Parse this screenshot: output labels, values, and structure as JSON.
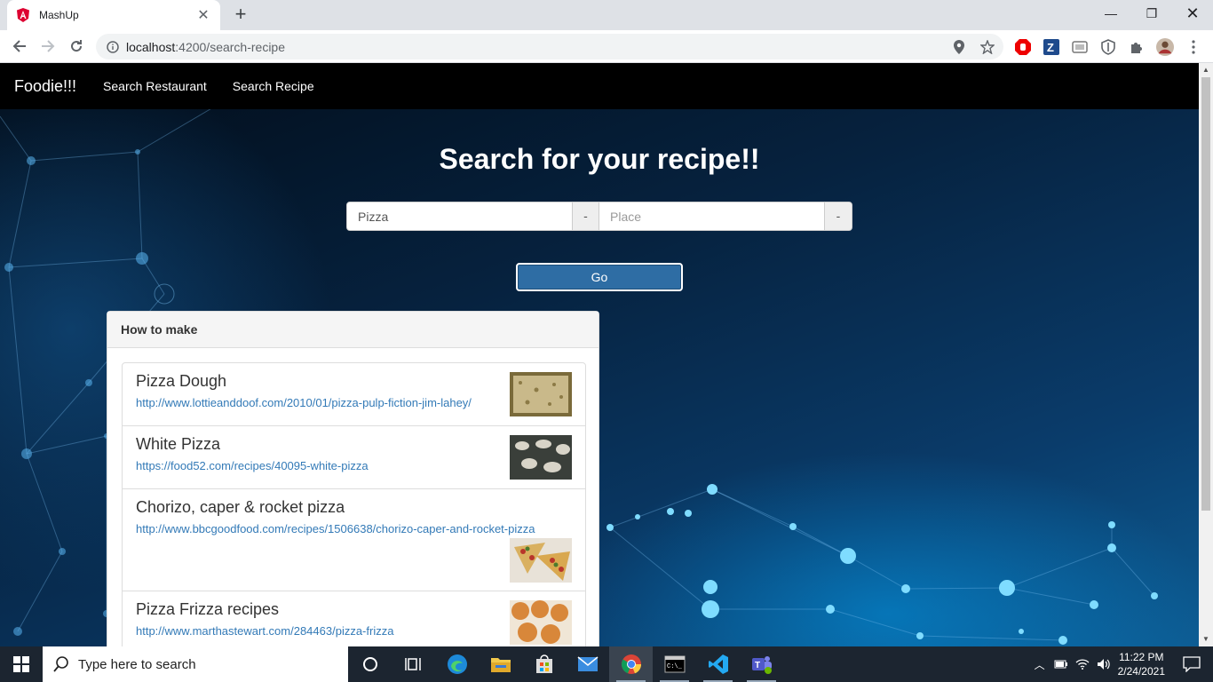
{
  "browser": {
    "tab_title": "MashUp",
    "url_host": "localhost",
    "url_rest": ":4200/search-recipe"
  },
  "navbar": {
    "brand": "Foodie!!!",
    "links": [
      "Search Restaurant",
      "Search Recipe"
    ]
  },
  "search": {
    "title": "Search for your recipe!!",
    "query_value": "Pizza",
    "query_addon": "-",
    "place_placeholder": "Place",
    "place_addon": "-",
    "go_label": "Go"
  },
  "results": {
    "heading": "How to make",
    "items": [
      {
        "title": "Pizza Dough",
        "url": "http://www.lottieanddoof.com/2010/01/pizza-pulp-fiction-jim-lahey/"
      },
      {
        "title": "White Pizza",
        "url": "https://food52.com/recipes/40095-white-pizza"
      },
      {
        "title": "Chorizo, caper & rocket pizza",
        "url": "http://www.bbcgoodfood.com/recipes/1506638/chorizo-caper-and-rocket-pizza"
      },
      {
        "title": "Pizza Frizza recipes",
        "url": "http://www.marthastewart.com/284463/pizza-frizza"
      }
    ]
  },
  "taskbar": {
    "search_placeholder": "Type here to search",
    "time": "11:22 PM",
    "date": "2/24/2021"
  },
  "colors": {
    "navbar": "#000000",
    "button": "#2e6da4",
    "link": "#337ab7"
  }
}
